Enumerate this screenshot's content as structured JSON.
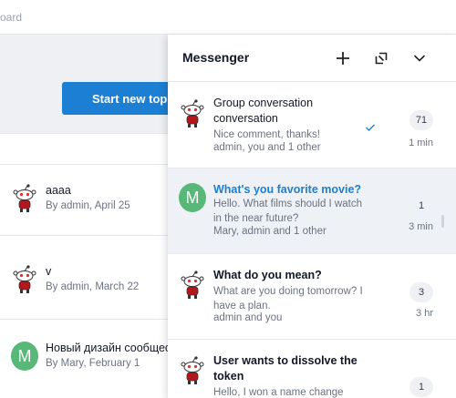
{
  "page": {
    "breadcrumb": "oard",
    "start_button": "Start new topic",
    "topics": [
      {
        "title": "aaaa",
        "meta": "By admin, April 25",
        "avatar": "reddit-robot-avatar"
      },
      {
        "title": "v",
        "meta": "By admin, March 22",
        "avatar": "reddit-robot-avatar"
      },
      {
        "title": "Новый дизайн сообщест",
        "meta": "By Mary, February 1",
        "avatar_letter": "M"
      }
    ]
  },
  "messenger": {
    "title": "Messenger",
    "header_icons": [
      "plus-icon",
      "popout-icon",
      "chevron-down-icon"
    ],
    "conversations": [
      {
        "title": "Group conversation conversation",
        "preview": "Nice comment, thanks!",
        "participants": "admin, you and 1 other",
        "count": "71",
        "time": "1 min",
        "read": true,
        "avatar": "reddit-robot-avatar"
      },
      {
        "title": "What's you favorite movie?",
        "preview": "Hello. What films should I watch in the near future?",
        "participants": "Mary, admin and 1 other",
        "count": "1",
        "time": "3 min",
        "active": true,
        "avatar_letter": "M"
      },
      {
        "title": "What do you mean?",
        "preview": "What are you doing tomorrow? I have a plan.",
        "participants": "admin and you",
        "count": "3",
        "time": "3 hr",
        "avatar": "reddit-robot-avatar"
      },
      {
        "title": "User wants to dissolve the token",
        "preview": "Hello, I won a name change",
        "participants": "",
        "count": "1",
        "time": "",
        "avatar": "reddit-robot-avatar"
      }
    ]
  },
  "colors": {
    "accent": "#1c7fd3",
    "avatar_green": "#57b878",
    "active_row": "#eef1f5"
  }
}
